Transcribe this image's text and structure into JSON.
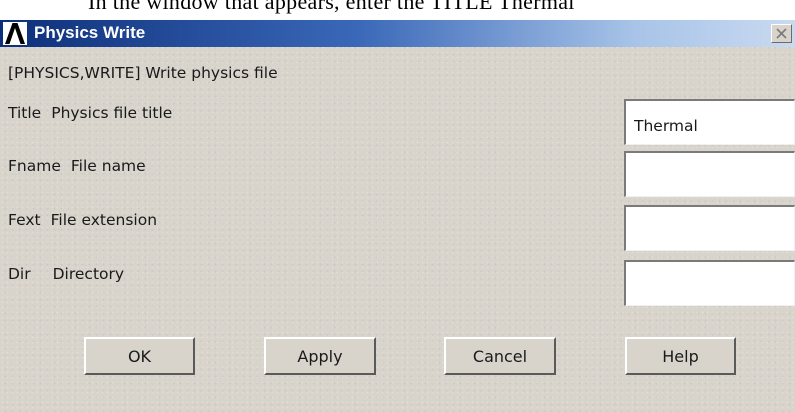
{
  "document": {
    "visible_text": "In the window that appears, enter the TITLE Thermal"
  },
  "dialog": {
    "title": "Physics Write",
    "command": "[PHYSICS,WRITE]  Write physics file",
    "fields": [
      {
        "key": "Title",
        "label": "Physics file title",
        "value": "Thermal"
      },
      {
        "key": "Fname",
        "label": "File name",
        "value": ""
      },
      {
        "key": "Fext",
        "label": "File extension",
        "value": ""
      },
      {
        "key": "Dir",
        "label": "Directory",
        "value": ""
      }
    ],
    "buttons": {
      "ok": "OK",
      "apply": "Apply",
      "cancel": "Cancel",
      "help": "Help"
    }
  },
  "colors": {
    "titlebar_start": "#0d2f7a",
    "titlebar_end": "#c9daf0",
    "dialog_bg": "#d8d4cc"
  },
  "icons": {
    "app": "ansys-logo-icon",
    "close": "close-icon"
  }
}
